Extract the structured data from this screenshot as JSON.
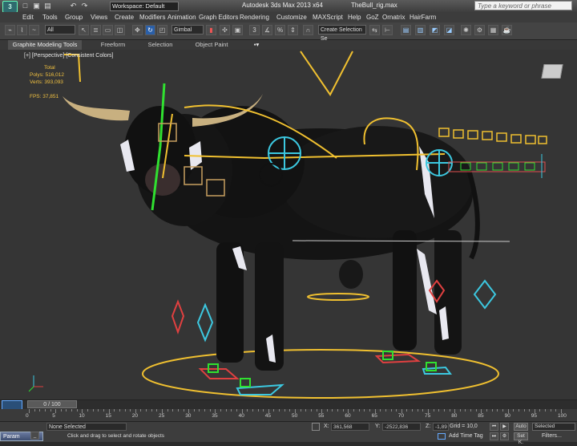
{
  "titlebar": {
    "logo": "3",
    "quick_access": [
      "□",
      "▣",
      "▤",
      "↶",
      "↷",
      "▾",
      "▦",
      "▾"
    ],
    "workspace": "Workspace: Default",
    "app_title": "Autodesk 3ds Max  2013 x64",
    "file_title": "TheBull_rig.max",
    "search_placeholder": "Type a keyword or phrase"
  },
  "menubar": {
    "items": [
      "Edit",
      "Tools",
      "Group",
      "Views",
      "Create",
      "Modifiers",
      "Animation",
      "Graph Editors",
      "Rendering",
      "Customize",
      "MAXScript",
      "Help",
      "GoZ",
      "Ornatrix",
      "HairFarm"
    ]
  },
  "toolbar": {
    "selection_filter": "All",
    "ref_coord": "Gimbal",
    "named_selection": "Create Selection Se",
    "snap_label": "3"
  },
  "ribbon": {
    "tabs": [
      "Graphite Modeling Tools",
      "Freeform",
      "Selection",
      "Object Paint"
    ]
  },
  "viewport": {
    "label": "[+] [Perspective] [Consistent Colors]",
    "stats": {
      "total_label": "Total",
      "polys": "Polys:   516,012",
      "verts": "Verts:   393,093",
      "fps": "FPS:     37,851"
    }
  },
  "timeline": {
    "thumb": "0 / 100",
    "ticks": [
      "0",
      "5",
      "10",
      "15",
      "20",
      "25",
      "30",
      "35",
      "40",
      "45",
      "50",
      "55",
      "60",
      "65",
      "70",
      "75",
      "80",
      "85",
      "90",
      "95",
      "100"
    ]
  },
  "statusbar": {
    "taskbar": "Param",
    "selected": "None Selected",
    "prompt": "Click and drag to select and rotate objects",
    "x_label": "X:",
    "x_value": "361,568",
    "y_label": "Y:",
    "y_value": "-2522,836",
    "z_label": "Z:",
    "z_value": "-1,89",
    "grid": "Grid = 10,0",
    "add_time_tag": "Add Time Tag",
    "auto": "Auto",
    "setk": "Set K.",
    "selected_dropdown": "Selected",
    "filters": "Filters..."
  },
  "colors": {
    "rig_yellow": "#f0c030",
    "rig_cyan": "#3cc8e0",
    "rig_green": "#30e030",
    "rig_red": "#e04040",
    "bull_body": "#111111",
    "horn": "#c8b080"
  }
}
